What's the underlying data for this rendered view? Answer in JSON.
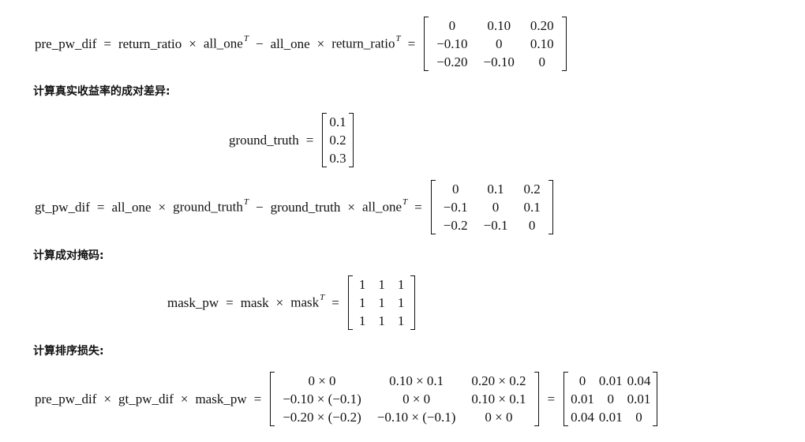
{
  "eq1": {
    "lhs": "pre_pw_dif",
    "eq": "=",
    "a": "return_ratio",
    "times1": "×",
    "b": "all_one",
    "b_sup": "T",
    "minus": "−",
    "c": "all_one",
    "times2": "×",
    "d": "return_ratio",
    "d_sup": "T",
    "eq2": "=",
    "matrix": [
      [
        "0",
        "0.10",
        "0.20"
      ],
      [
        "−0.10",
        "0",
        "0.10"
      ],
      [
        "−0.20",
        "−0.10",
        "0"
      ]
    ]
  },
  "heading1": "计算真实收益率的成对差异:",
  "eq2": {
    "lhs": "ground_truth",
    "eq": "=",
    "matrix": [
      [
        "0.1"
      ],
      [
        "0.2"
      ],
      [
        "0.3"
      ]
    ]
  },
  "eq3": {
    "lhs": "gt_pw_dif",
    "eq": "=",
    "a": "all_one",
    "times1": "×",
    "b": "ground_truth",
    "b_sup": "T",
    "minus": "−",
    "c": "ground_truth",
    "times2": "×",
    "d": "all_one",
    "d_sup": "T",
    "eq2": "=",
    "matrix": [
      [
        "0",
        "0.1",
        "0.2"
      ],
      [
        "−0.1",
        "0",
        "0.1"
      ],
      [
        "−0.2",
        "−0.1",
        "0"
      ]
    ]
  },
  "heading2": "计算成对掩码:",
  "eq4": {
    "lhs": "mask_pw",
    "eq": "=",
    "a": "mask",
    "times": "×",
    "b": "mask",
    "b_sup": "T",
    "eq2": "=",
    "matrix": [
      [
        "1",
        "1",
        "1"
      ],
      [
        "1",
        "1",
        "1"
      ],
      [
        "1",
        "1",
        "1"
      ]
    ]
  },
  "heading3": "计算排序损失:",
  "eq5": {
    "a": "pre_pw_dif",
    "times1": "×",
    "b": "gt_pw_dif",
    "times2": "×",
    "c": "mask_pw",
    "eq": "=",
    "matrix1": [
      [
        "0 × 0",
        "0.10 × 0.1",
        "0.20 × 0.2"
      ],
      [
        "−0.10 × (−0.1)",
        "0 × 0",
        "0.10 × 0.1"
      ],
      [
        "−0.20 × (−0.2)",
        "−0.10 × (−0.1)",
        "0 × 0"
      ]
    ],
    "eq2": "=",
    "matrix2": [
      [
        "0",
        "0.01",
        "0.04"
      ],
      [
        "0.01",
        "0",
        "0.01"
      ],
      [
        "0.04",
        "0.01",
        "0"
      ]
    ]
  }
}
